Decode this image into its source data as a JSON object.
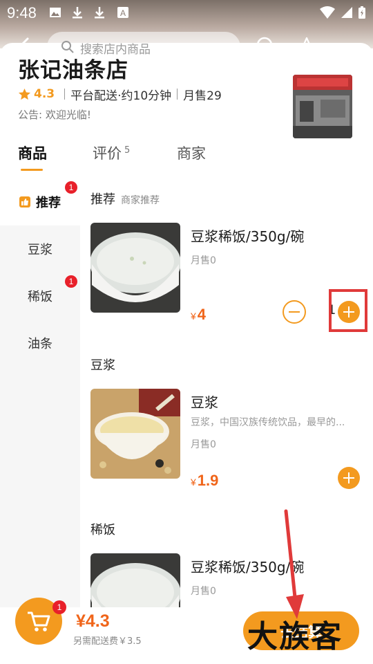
{
  "status_bar": {
    "time": "9:48"
  },
  "search": {
    "placeholder": "搜索店内商品"
  },
  "shop": {
    "name": "张记油条店",
    "rating": "4.3",
    "delivery": "平台配送·约10分钟",
    "monthly_sales": "月售29",
    "notice": "公告: 欢迎光临!"
  },
  "tabs": [
    {
      "label": "商品",
      "active": true
    },
    {
      "label": "评价",
      "count": "5"
    },
    {
      "label": "商家"
    }
  ],
  "sidebar": {
    "items": [
      {
        "label": "推荐",
        "badge": "1",
        "active": true
      },
      {
        "label": "豆浆"
      },
      {
        "label": "稀饭",
        "badge": "1"
      },
      {
        "label": "油条"
      }
    ]
  },
  "sections": [
    {
      "title": "推荐",
      "subtitle": "商家推荐",
      "products": [
        {
          "name": "豆浆稀饭/350g/碗",
          "sales": "月售0",
          "currency": "¥",
          "price": "4",
          "quantity": "1"
        }
      ]
    },
    {
      "title": "豆浆",
      "products": [
        {
          "name": "豆浆",
          "desc": "豆浆，中国汉族传统饮品，最早的...",
          "sales": "月售0",
          "currency": "¥",
          "price": "1.9"
        }
      ]
    },
    {
      "title": "稀饭",
      "products": [
        {
          "name": "豆浆稀饭/350g/碗",
          "sales": "月售0"
        }
      ]
    }
  ],
  "cart": {
    "badge": "1",
    "total": "¥4.3",
    "delivery_fee_note": "另需配送费￥3.5",
    "checkout_label": "去结算"
  },
  "watermark": "大族客",
  "colors": {
    "accent": "#f39a1f",
    "price": "#f0651a",
    "badge": "#e8202a",
    "annotation": "#e03a3a"
  }
}
